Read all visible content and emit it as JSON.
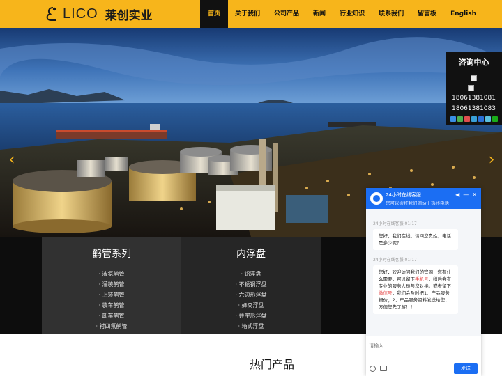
{
  "brand": {
    "logo_en": "LICO",
    "logo_cn": "莱创实业",
    "accent": "#f7b51b",
    "dark": "#111111"
  },
  "nav": {
    "items": [
      {
        "label": "首页",
        "active": true
      },
      {
        "label": "关于我们",
        "active": false
      },
      {
        "label": "公司产品",
        "active": false
      },
      {
        "label": "新闻",
        "active": false
      },
      {
        "label": "行业知识",
        "active": false
      },
      {
        "label": "联系我们",
        "active": false
      },
      {
        "label": "留言板",
        "active": false
      },
      {
        "label": "English",
        "active": false
      }
    ]
  },
  "banner": {
    "prev_icon": "chevron-left-icon",
    "next_icon": "chevron-right-icon",
    "prev_label": "‹",
    "next_label": "›"
  },
  "categories": [
    {
      "title": "鹤管系列",
      "items": [
        "· 液氨鹤管",
        "· 灌装鹤管",
        "· 上装鹤管",
        "· 装车鹤管",
        "· 卸车鹤管",
        "· 衬四氟鹤管"
      ]
    },
    {
      "title": "内浮盘",
      "items": [
        "· 铝浮盘",
        "· 不锈钢浮盘",
        "· 六边形浮盘",
        "· 蜂窝浮盘",
        "· 井字形浮盘",
        "· 箱式浮盘"
      ]
    }
  ],
  "hot_products": {
    "title": "热门产品"
  },
  "consult": {
    "title": "咨询中心",
    "phones": [
      "18061381081",
      "18061381083"
    ],
    "share_colors": [
      "#3a8ee6",
      "#4caf50",
      "#e04e4e",
      "#39a0d8",
      "#2a6fd6",
      "#5bc0de",
      "#1aad19"
    ]
  },
  "chat": {
    "name": "24小时在线客服",
    "subtitle": "您可以拨打我们网站上热线电话",
    "messages": [
      {
        "meta": "24小时在线客服 01:17",
        "parts": [
          "您好，我们在线，请问您贵姓，电话是多少呢？"
        ]
      },
      {
        "meta": "24小时在线客服 01:17",
        "parts": [
          "您好，欢迎访问我们的官网！您有什么需要，可以留下",
          "手机号",
          "，稍后会有专业的服务人员与您对接。或者留下",
          "微信号",
          "，我们会及时把1、产品服务报价；2、产品服务资料发送给您，方便您先了解！！"
        ]
      }
    ],
    "input_placeholder": "请输入",
    "send_label": "发送"
  }
}
